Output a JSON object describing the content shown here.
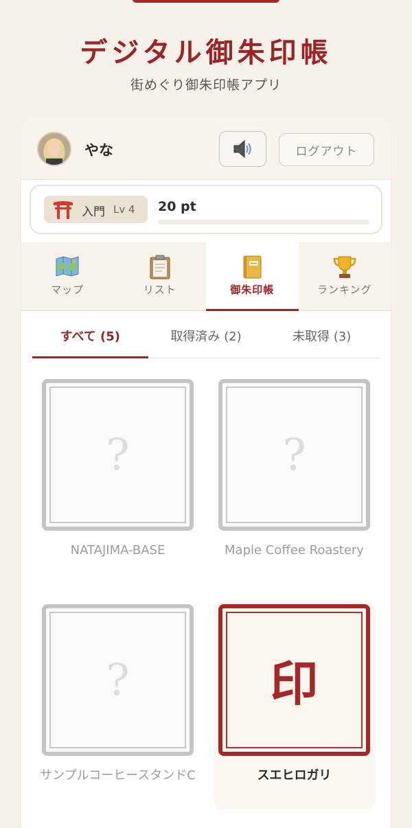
{
  "header": {
    "title": "デジタル御朱印帳",
    "subtitle": "街めぐり御朱印帳アプリ"
  },
  "user": {
    "name": "やな",
    "logout_label": "ログアウト",
    "sound_icon": "speaker-icon"
  },
  "level": {
    "rank_name": "入門",
    "level_label": "Lv 4",
    "points": "20 pt",
    "progress": 0.0,
    "rank_icon": "torii-icon"
  },
  "nav": {
    "tabs": [
      {
        "label": "マップ",
        "icon": "map-icon",
        "active": false
      },
      {
        "label": "リスト",
        "icon": "clipboard-icon",
        "active": false
      },
      {
        "label": "御朱印帳",
        "icon": "notebook-icon",
        "active": true
      },
      {
        "label": "ランキング",
        "icon": "trophy-icon",
        "active": false
      }
    ]
  },
  "filters": {
    "tabs": [
      {
        "label": "すべて (5)",
        "active": true
      },
      {
        "label": "取得済み (2)",
        "active": false
      },
      {
        "label": "未取得 (3)",
        "active": false
      }
    ]
  },
  "stamps": [
    {
      "name": "NATAJIMA-BASE",
      "acquired": false,
      "mark": "?"
    },
    {
      "name": "Maple Coffee Roastery",
      "acquired": false,
      "mark": "?"
    },
    {
      "name": "サンプルコーヒースタンドC",
      "acquired": false,
      "mark": "?"
    },
    {
      "name": "スエヒロガリ",
      "acquired": true,
      "mark": "印"
    }
  ],
  "colors": {
    "accent": "#9b2525",
    "background": "#f6f2eb",
    "locked_border": "#c4c4c4"
  }
}
